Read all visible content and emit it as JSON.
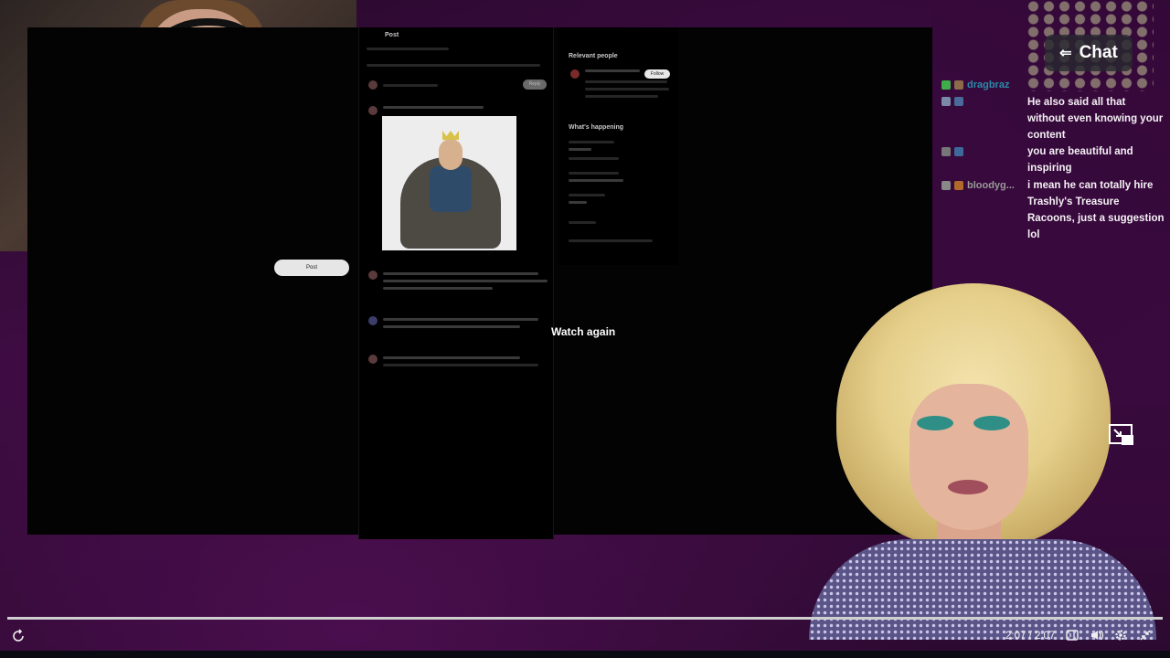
{
  "x_post": {
    "header": "Post",
    "reply_label": "Reply",
    "relevant_people_heading": "Relevant people",
    "whats_happening_heading": "What's happening",
    "post_button_label": "Post",
    "follow_label": "Follow"
  },
  "overlay": {
    "watch_again": "Watch again"
  },
  "chat": {
    "button_label": "Chat",
    "users": [
      "dragbraz",
      "",
      "bloodyg..."
    ],
    "messages": [
      "He also said all that without even knowing your content",
      "you are beautiful and inspiring",
      "i mean he can totally hire Trashly's Treasure Racoons, just a suggestion lol"
    ]
  },
  "player": {
    "time_display": "2:07 / 2:07",
    "progress_fraction": 1.0
  },
  "colors": {
    "chat_overlay": "#370a3c",
    "progress_bar": "#cfcfcf"
  },
  "icons": [
    "replay-icon",
    "captions-icon",
    "volume-icon",
    "settings-icon",
    "exit-fullscreen-icon",
    "picture-in-picture-icon",
    "chat-collapse-icon"
  ]
}
